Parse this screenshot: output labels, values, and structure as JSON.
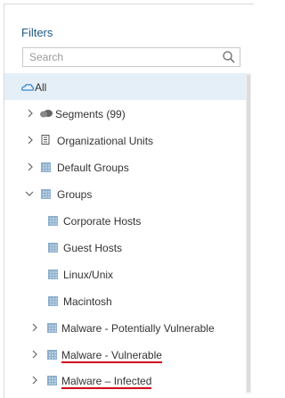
{
  "filters": {
    "title": "Filters",
    "search_placeholder": "Search"
  },
  "tree": {
    "all_label": "All",
    "segments_label": "Segments (99)",
    "org_units_label": "Organizational Units",
    "default_groups_label": "Default Groups",
    "groups_label": "Groups",
    "children": {
      "corporate_hosts": "Corporate Hosts",
      "guest_hosts": "Guest Hosts",
      "linux_unix": "Linux/Unix",
      "macintosh": "Macintosh",
      "malware_potentially_vulnerable": "Malware - Potentially Vulnerable",
      "malware_vulnerable": "Malware - Vulnerable",
      "malware_infected": "Malware – Infected"
    }
  },
  "colors": {
    "title": "#1e5a86",
    "selected_row": "#e5eff7",
    "annotation_underline": "#d0021b"
  }
}
